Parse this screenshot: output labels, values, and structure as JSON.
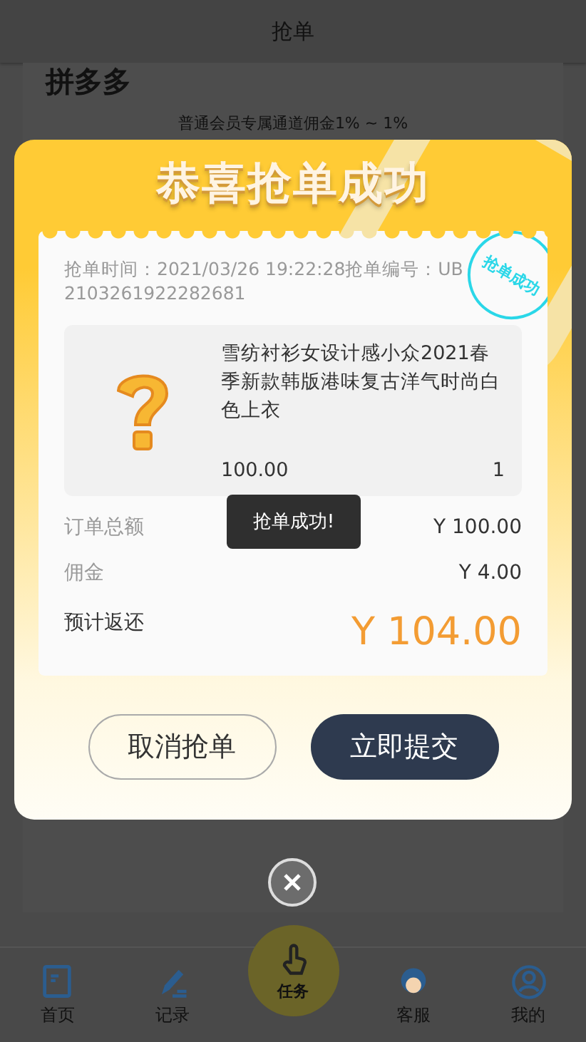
{
  "header": {
    "title": "抢单"
  },
  "page": {
    "platform": "拼多多",
    "subtitle": "普通会员专属通道佣金1% ~ 1%"
  },
  "modal": {
    "title": "恭喜抢单成功",
    "stamp": "抢单成功",
    "order_info": "抢单时间：2021/03/26 19:22:28抢单编号：UB2103261922282681",
    "product": {
      "name": "雪纺衬衫女设计感小众2021春季新款韩版港味复古洋气时尚白色上衣",
      "price": "100.00",
      "quantity": "1"
    },
    "summary": [
      {
        "label": "订单总额",
        "value": "Y 100.00",
        "kind": "normal"
      },
      {
        "label": "佣金",
        "value": "Y 4.00",
        "kind": "normal"
      },
      {
        "label": "预计返还",
        "value": "Y 104.00",
        "kind": "total"
      }
    ],
    "buttons": [
      {
        "label": "取消抢单",
        "kind": "secondary"
      },
      {
        "label": "立即提交",
        "kind": "primary"
      }
    ]
  },
  "toast": "抢单成功!",
  "nav": [
    {
      "label": "首页",
      "kind": "home",
      "selected": false
    },
    {
      "label": "记录",
      "kind": "record",
      "selected": false
    },
    {
      "label": "任务",
      "kind": "task",
      "selected": true
    },
    {
      "label": "客服",
      "kind": "service",
      "selected": false
    },
    {
      "label": "我的",
      "kind": "profile",
      "selected": false
    }
  ]
}
